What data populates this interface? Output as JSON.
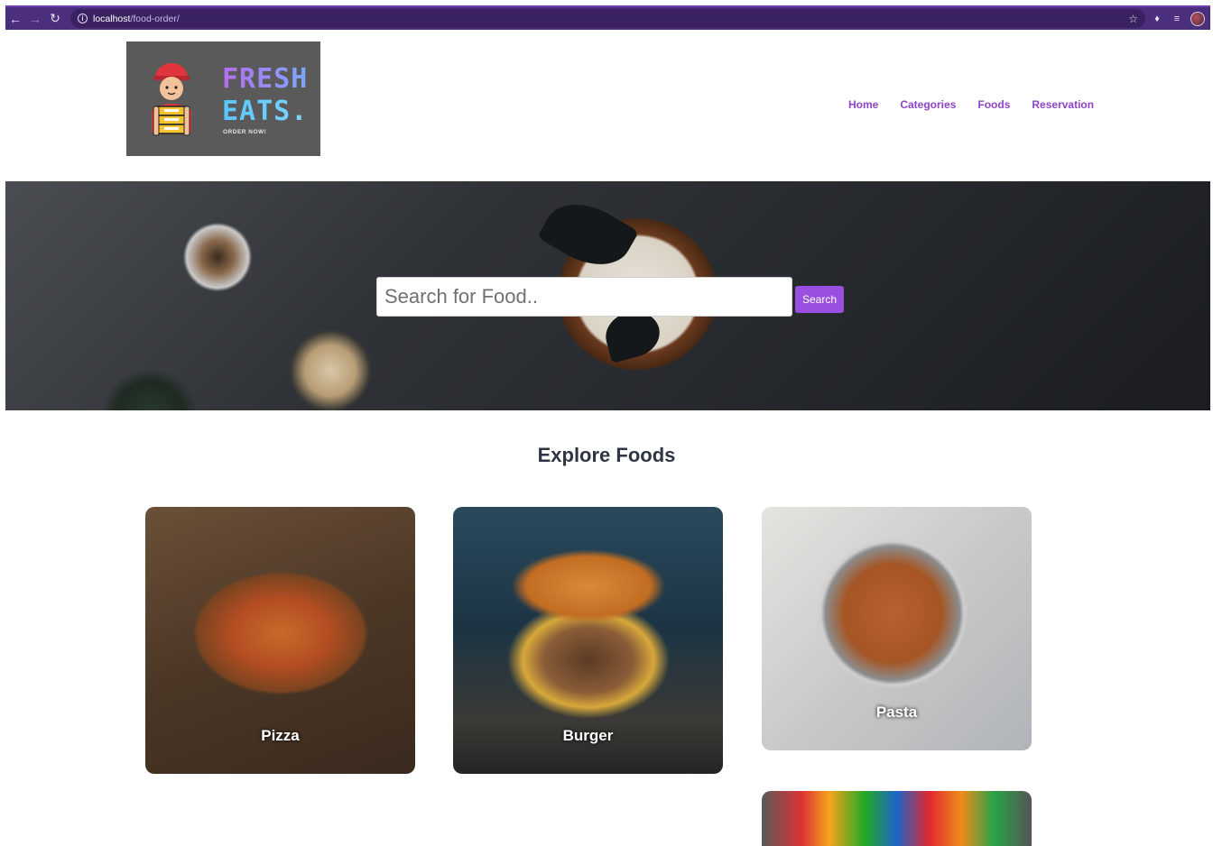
{
  "browser": {
    "url_host": "localhost",
    "url_path": "/food-order/"
  },
  "logo": {
    "line1": "FRESH",
    "line2": "EATS.",
    "tagline": "ORDER NOW!"
  },
  "nav": {
    "items": [
      {
        "label": "Home"
      },
      {
        "label": "Categories"
      },
      {
        "label": "Foods"
      },
      {
        "label": "Reservation"
      }
    ]
  },
  "search": {
    "placeholder": "Search for Food..",
    "button_label": "Search"
  },
  "explore": {
    "title": "Explore Foods",
    "cards": [
      {
        "label": "Pizza"
      },
      {
        "label": "Burger"
      },
      {
        "label": "Pasta"
      }
    ]
  },
  "colors": {
    "accent": "#9b4fe0",
    "nav_link": "#8e44c8",
    "browser_frame": "#4b2f7c",
    "heading": "#2f3542"
  }
}
